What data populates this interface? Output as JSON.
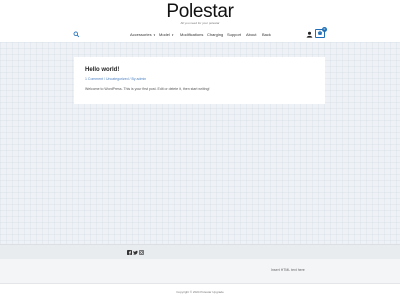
{
  "header": {
    "logo": "Polestar",
    "tagline": "All you need for your polestar"
  },
  "nav": {
    "items": [
      {
        "label": "Accessories",
        "dropdown": true
      },
      {
        "label": "Model",
        "dropdown": true
      },
      {
        "label": "Modifications",
        "dropdown": false
      },
      {
        "label": "Charging",
        "dropdown": false
      },
      {
        "label": "Support",
        "dropdown": false
      },
      {
        "label": "About",
        "dropdown": false
      },
      {
        "label": "Back",
        "dropdown": false
      }
    ],
    "cart_count": "0"
  },
  "post": {
    "title": "Hello world!",
    "meta": "1 Comment / Uncategorized / By admin",
    "body": "Welcome to WordPress. This is your first post. Edit or delete it, then start writing!"
  },
  "footer": {
    "social_icons": [
      "facebook-icon",
      "twitter-icon",
      "instagram-icon"
    ],
    "html_block": "Insert HTML text here",
    "copyright": "Copyright © 2024 Polestar Upgrade"
  },
  "colors": {
    "accent": "#1f6fb8",
    "link": "#4a7fc1",
    "background": "#eef2f6"
  }
}
